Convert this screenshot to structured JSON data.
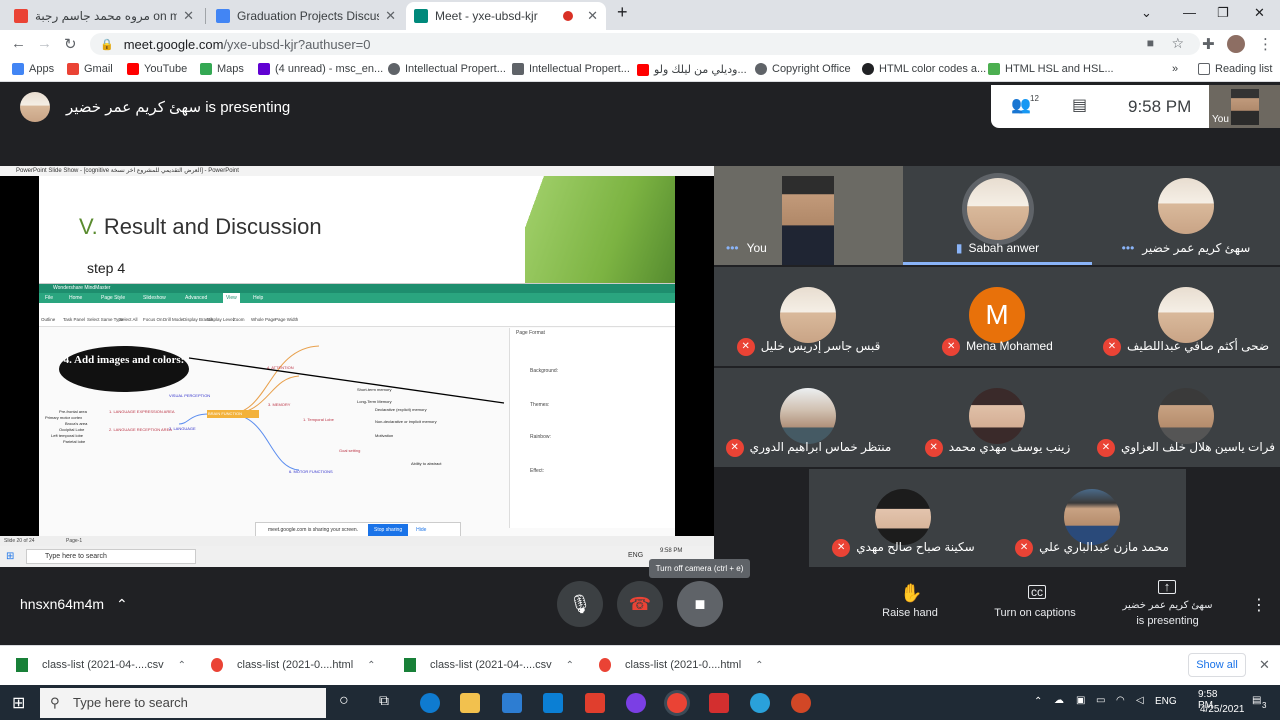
{
  "browser": {
    "tabs": [
      {
        "title": "مروه محمد جاسم رجبة on mented"
      },
      {
        "title": "Graduation Projects Discussing G"
      },
      {
        "title": "Meet - yxe-ubsd-kjr"
      }
    ],
    "new_tab": "+",
    "url_host": "meet.google.com",
    "url_path": "/yxe-ubsd-kjr?authuser=0",
    "bookmarks": [
      {
        "label": "Apps",
        "color": "#4285f4"
      },
      {
        "label": "Gmail",
        "color": "#ea4335"
      },
      {
        "label": "YouTube",
        "color": "#ff0000"
      },
      {
        "label": "Maps",
        "color": "#34a853"
      },
      {
        "label": "(4 unread) - msc_en...",
        "color": "#6001d2"
      },
      {
        "label": "Intellectual Propert...",
        "color": "#5f6368"
      },
      {
        "label": "Intellectual Propert...",
        "color": "#5f6368"
      },
      {
        "label": "وديلي من ليلك ولو...",
        "color": "#ff0000"
      },
      {
        "label": "Copyright Office",
        "color": "#5f6368"
      },
      {
        "label": "HTML color codes a...",
        "color": "#202124"
      },
      {
        "label": "HTML HSL and HSL...",
        "color": "#4caf50"
      }
    ],
    "reading_list": "Reading list",
    "more": "»"
  },
  "meet": {
    "presenter_banner": "سهئ كريم عمر خضير is presenting",
    "participants_count": "12",
    "clock": "9:58 PM",
    "self_label": "You",
    "meeting_code": "hnsxn64m4m",
    "slide": {
      "ppt_title": "PowerPoint Slide Show - [cognitive العرض التقديمي للمشروع اخر نسخة] - PowerPoint",
      "heading_num": "V.",
      "heading": "Result and Discussion",
      "subheading": "step 4",
      "mm_app": "Wondershare MindMaster",
      "mm_menu": [
        "File",
        "Home",
        "Page Style",
        "Slideshow",
        "Advanced",
        "View",
        "Help"
      ],
      "mm_tools": [
        "Outline",
        "Task Panel",
        "Select Same Type",
        "Select All",
        "Focus On",
        "Drill Mode",
        "Display Branch",
        "Display Level",
        "Zoom",
        "Whole Page",
        "Page Width"
      ],
      "cloud": "4. Add images and colors:",
      "center_node": "BRAIN FUNCTION",
      "nodes": [
        "4. ATTENTION",
        "3. MEMORY",
        "1. Temporal Lobe",
        "2. LANGUAGE",
        "6. MOTOR FUNCTIONS",
        "VISUAL PERCEPTION",
        "1. LANGUAGE EXPRESSION AREA",
        "2. LANGUAGE RECEPTION AREA",
        "Pre-frontal area",
        "Primary motor cortex",
        "Broca's area",
        "Occipital Lobe",
        "Left temporal lobe",
        "Parietal lobe",
        "Short-term memory",
        "Long-Term Memory",
        "Declarative (explicit) memory",
        "Non-declarative or implicit memory",
        "Motivation",
        "Goal setting",
        "Ability to abstract"
      ],
      "panel_title": "Page Format",
      "panel_labels": [
        "Background:",
        "Themes:",
        "Rainbow:",
        "Effect:"
      ],
      "share_text": "meet.google.com is sharing your screen.",
      "stop_sharing": "Stop sharing",
      "hide": "Hide",
      "status_left": "Slide 20 of 24",
      "status_page": "Page-1",
      "taskbar_search": "Type here to search",
      "taskbar_time": "9:58 PM",
      "taskbar_lang": "ENG"
    },
    "participants": [
      {
        "name": "You",
        "muted": false
      },
      {
        "name": "Sabah anwer",
        "muted": false
      },
      {
        "name": "سهئ كريم عمر خضير",
        "muted": false
      },
      {
        "name": "قبس جاسر إدريس خليل",
        "muted": true
      },
      {
        "name": "Mena Mohamed",
        "muted": true,
        "initial": "M"
      },
      {
        "name": "ضحى أكثم صافي عبداللطيف",
        "muted": true
      },
      {
        "name": "منتظر خماس ابراهيم الدوري",
        "muted": true
      },
      {
        "name": "زينب يوسف مهدي محمد",
        "muted": true
      },
      {
        "name": "فرات ياسين هلال خلف العزاوي",
        "muted": true
      },
      {
        "name": "سكينة صباح صالح مهدي",
        "muted": true
      },
      {
        "name": "محمد مازن عبدالباري علي",
        "muted": true
      }
    ],
    "controls": {
      "raise_hand": "Raise hand",
      "captions": "Turn on captions",
      "presenting_name": "سهئ كريم عمر خضير",
      "presenting_label": "is presenting",
      "tooltip": "Turn off camera (ctrl + e)"
    }
  },
  "downloads": {
    "items": [
      {
        "name": "class-list (2021-04-....csv",
        "color": "#188038"
      },
      {
        "name": "class-list (2021-0....html",
        "color": "#ea4335"
      },
      {
        "name": "class-list (2021-04-....csv",
        "color": "#188038"
      },
      {
        "name": "class-list (2021-0....html",
        "color": "#ea4335"
      }
    ],
    "show_all": "Show all"
  },
  "taskbar": {
    "search": "Type here to search",
    "lang": "ENG",
    "time": "9:58 PM",
    "date": "4/25/2021",
    "notifications": "3"
  }
}
